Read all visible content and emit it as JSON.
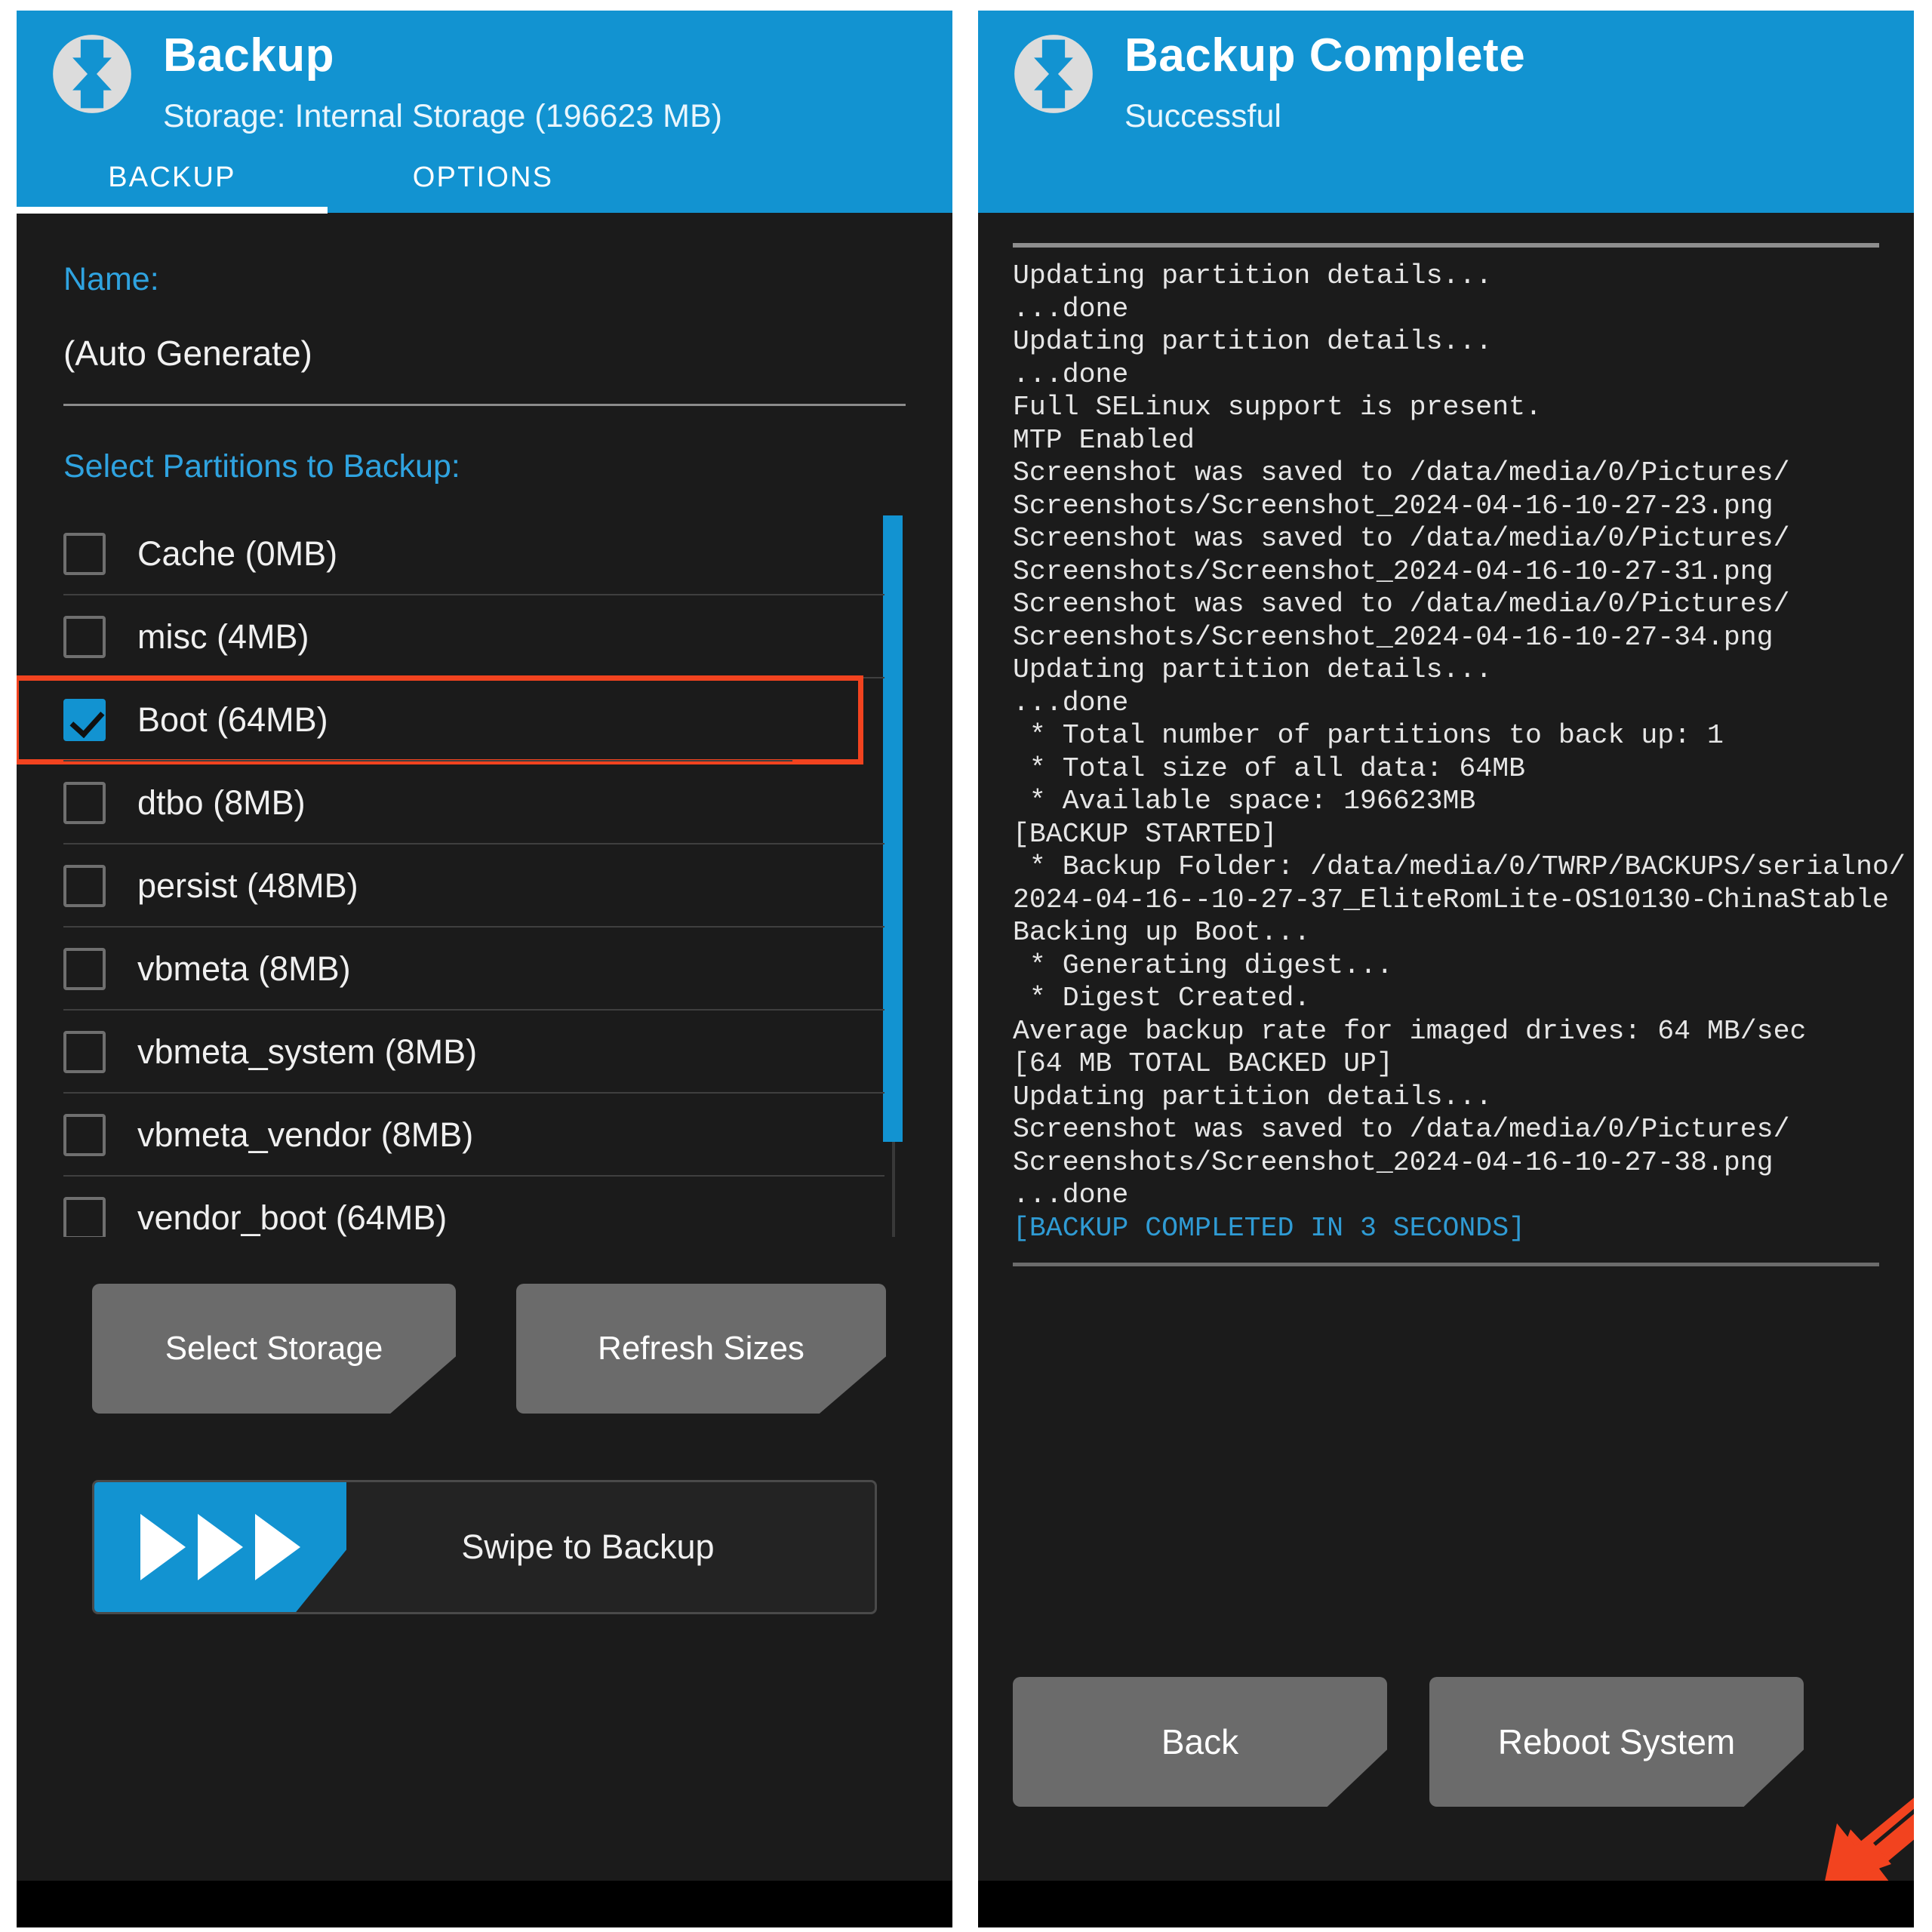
{
  "left_panel": {
    "header": {
      "logo_icon": "twrp-logo-icon",
      "title": "Backup",
      "subtitle": "Storage: Internal Storage (196623 MB)"
    },
    "tabs": [
      {
        "label": "BACKUP",
        "active": true
      },
      {
        "label": "OPTIONS",
        "active": false
      }
    ],
    "name_section": {
      "label": "Name:",
      "value": "(Auto Generate)"
    },
    "partitions_section": {
      "label": "Select Partitions to Backup:",
      "items": [
        {
          "label": "Cache (0MB)",
          "checked": false,
          "highlighted": false
        },
        {
          "label": "misc (4MB)",
          "checked": false,
          "highlighted": false
        },
        {
          "label": "Boot (64MB)",
          "checked": true,
          "highlighted": true
        },
        {
          "label": "dtbo (8MB)",
          "checked": false,
          "highlighted": false
        },
        {
          "label": "persist (48MB)",
          "checked": false,
          "highlighted": false
        },
        {
          "label": "vbmeta (8MB)",
          "checked": false,
          "highlighted": false
        },
        {
          "label": "vbmeta_system (8MB)",
          "checked": false,
          "highlighted": false
        },
        {
          "label": "vbmeta_vendor (8MB)",
          "checked": false,
          "highlighted": false
        },
        {
          "label": "vendor_boot (64MB)",
          "checked": false,
          "highlighted": false
        }
      ]
    },
    "buttons": {
      "select_storage": "Select Storage",
      "refresh_sizes": "Refresh Sizes"
    },
    "swipe": {
      "label": "Swipe to Backup",
      "arrow_icon": "triple-chevron-right-icon"
    }
  },
  "right_panel": {
    "header": {
      "logo_icon": "twrp-logo-icon",
      "title": "Backup Complete",
      "subtitle": "Successful"
    },
    "console_lines": [
      {
        "text": "Updating partition details...",
        "color": "default"
      },
      {
        "text": "...done",
        "color": "default"
      },
      {
        "text": "Updating partition details...",
        "color": "default"
      },
      {
        "text": "...done",
        "color": "default"
      },
      {
        "text": "Full SELinux support is present.",
        "color": "default"
      },
      {
        "text": "MTP Enabled",
        "color": "default"
      },
      {
        "text": "Screenshot was saved to /data/media/0/Pictures/",
        "color": "default"
      },
      {
        "text": "Screenshots/Screenshot_2024-04-16-10-27-23.png",
        "color": "default"
      },
      {
        "text": "Screenshot was saved to /data/media/0/Pictures/",
        "color": "default"
      },
      {
        "text": "Screenshots/Screenshot_2024-04-16-10-27-31.png",
        "color": "default"
      },
      {
        "text": "Screenshot was saved to /data/media/0/Pictures/",
        "color": "default"
      },
      {
        "text": "Screenshots/Screenshot_2024-04-16-10-27-34.png",
        "color": "default"
      },
      {
        "text": "Updating partition details...",
        "color": "default"
      },
      {
        "text": "...done",
        "color": "default"
      },
      {
        "text": " * Total number of partitions to back up: 1",
        "color": "default"
      },
      {
        "text": " * Total size of all data: 64MB",
        "color": "default"
      },
      {
        "text": " * Available space: 196623MB",
        "color": "default"
      },
      {
        "text": "[BACKUP STARTED]",
        "color": "default"
      },
      {
        "text": " * Backup Folder: /data/media/0/TWRP/BACKUPS/serialno/",
        "color": "default"
      },
      {
        "text": "2024-04-16--10-27-37_EliteRomLite-OS10130-ChinaStable",
        "color": "default"
      },
      {
        "text": "Backing up Boot...",
        "color": "default"
      },
      {
        "text": " * Generating digest...",
        "color": "default"
      },
      {
        "text": " * Digest Created.",
        "color": "default"
      },
      {
        "text": "Average backup rate for imaged drives: 64 MB/sec",
        "color": "default"
      },
      {
        "text": "[64 MB TOTAL BACKED UP]",
        "color": "default"
      },
      {
        "text": "Updating partition details...",
        "color": "default"
      },
      {
        "text": "Screenshot was saved to /data/media/0/Pictures/",
        "color": "default"
      },
      {
        "text": "Screenshots/Screenshot_2024-04-16-10-27-38.png",
        "color": "default"
      },
      {
        "text": "...done",
        "color": "default"
      },
      {
        "text": "[BACKUP COMPLETED IN 3 SECONDS]",
        "color": "blue"
      }
    ],
    "buttons": {
      "back": "Back",
      "reboot_system": "Reboot System"
    },
    "annotation": {
      "arrow_icon": "red-arrow-pointing-down-left",
      "color": "#f2431f"
    }
  },
  "colors": {
    "accent_blue": "#1293d1",
    "label_blue": "#2fa3e0",
    "highlight_red": "#f2431f",
    "button_gray": "#6b6b6b",
    "background_dark": "#1b1b1b"
  }
}
